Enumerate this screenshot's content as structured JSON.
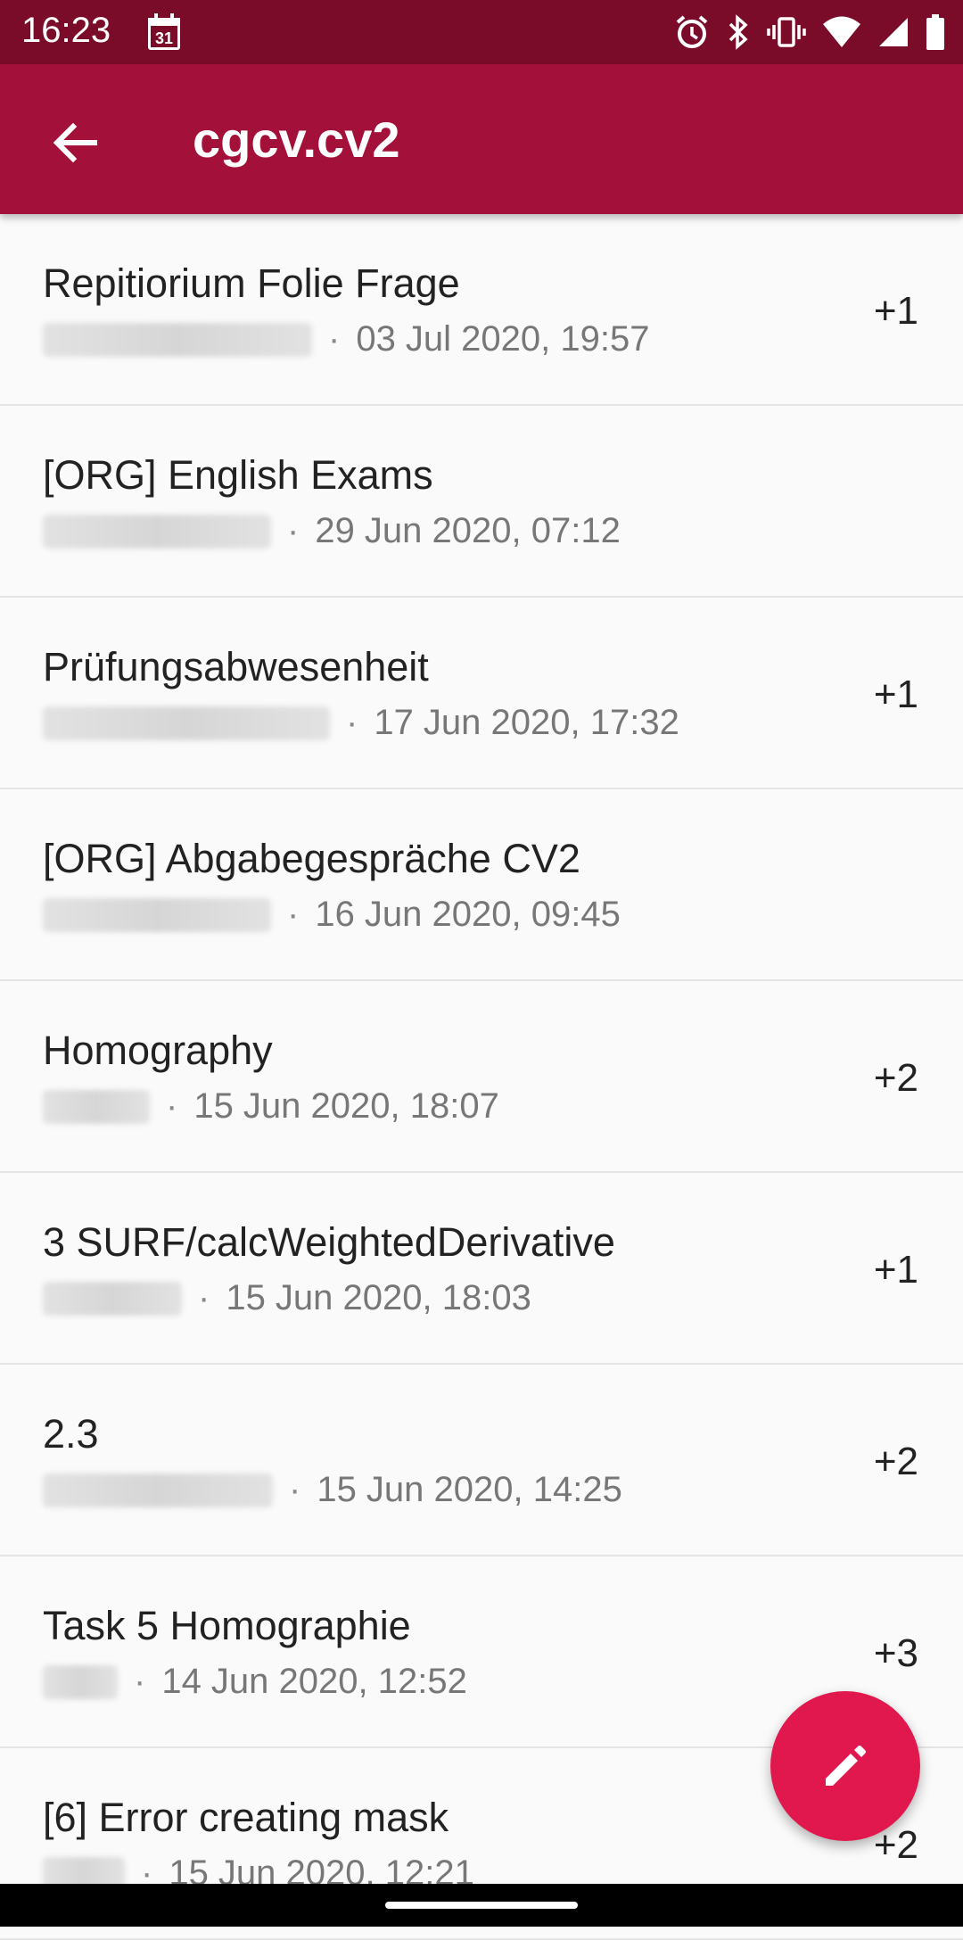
{
  "status_bar": {
    "time": "16:23",
    "calendar_day": "31",
    "icons": [
      "calendar-icon",
      "alarm-icon",
      "bluetooth-icon",
      "vibrate-icon",
      "wifi-icon",
      "cellular-icon",
      "battery-icon"
    ]
  },
  "app_bar": {
    "title": "cgcv.cv2",
    "back_icon": "arrow-back-icon"
  },
  "colors": {
    "status_bar": "#7a0b29",
    "app_bar": "#a3103a",
    "fab": "#e0184e",
    "background": "#fafafa"
  },
  "threads": [
    {
      "title": "Repitiorium Folie Frage",
      "separator": "·",
      "date": "03 Jul 2020, 19:57",
      "replies": "+1"
    },
    {
      "title": "[ORG] English Exams",
      "separator": "·",
      "date": "29 Jun 2020, 07:12",
      "replies": ""
    },
    {
      "title": "Prüfungsabwesenheit",
      "separator": "·",
      "date": "17 Jun 2020, 17:32",
      "replies": "+1"
    },
    {
      "title": "[ORG] Abgabegespräche CV2",
      "separator": "·",
      "date": "16 Jun 2020, 09:45",
      "replies": ""
    },
    {
      "title": "Homography",
      "separator": "·",
      "date": "15 Jun 2020, 18:07",
      "replies": "+2"
    },
    {
      "title": "3 SURF/calcWeightedDerivative",
      "separator": "·",
      "date": "15 Jun 2020, 18:03",
      "replies": "+1"
    },
    {
      "title": "2.3",
      "separator": "·",
      "date": "15 Jun 2020, 14:25",
      "replies": "+2"
    },
    {
      "title": "Task 5 Homographie",
      "separator": "·",
      "date": "14 Jun 2020, 12:52",
      "replies": "+3"
    },
    {
      "title": "[6] Error creating mask",
      "separator": "·",
      "date": "15 Jun 2020, 12:21",
      "replies": "+2"
    }
  ],
  "fab": {
    "icon": "pencil-icon"
  }
}
